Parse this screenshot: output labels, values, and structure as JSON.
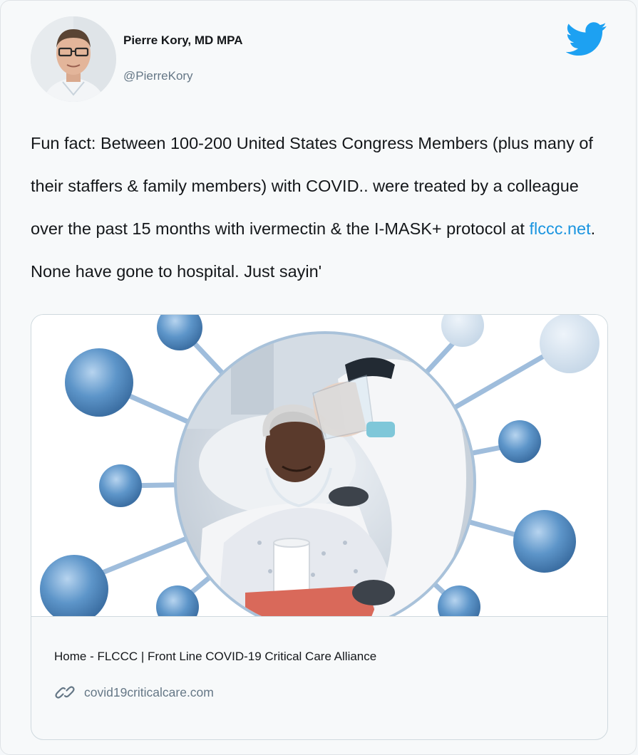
{
  "author": {
    "name": "Pierre Kory, MD MPA",
    "handle": "@PierreKory",
    "avatar_icon": "person-avatar"
  },
  "brand": {
    "icon": "twitter-bird-icon",
    "color": "#1da1f2"
  },
  "tweet": {
    "text_before_link": "Fun fact: Between 100-200 United States Congress Members (plus many of their staffers & family members) with COVID.. were treated by a colleague over the past 15 months with ivermectin & the I-MASK+ protocol at ",
    "link_text": "flccc.net",
    "text_after_link": ". None have gone to hospital. Just sayin'",
    "link_color": "#1b95e0"
  },
  "link_card": {
    "image_icon": "virus-patient-illustration",
    "title": "Home - FLCCC | Front Line COVID-19 Critical Care Alliance",
    "domain_icon": "link-icon",
    "domain": "covid19criticalcare.com"
  },
  "colors": {
    "text_primary": "#14171a",
    "text_secondary": "#657786",
    "border": "#cfd9de",
    "background": "#f7f9fa"
  }
}
